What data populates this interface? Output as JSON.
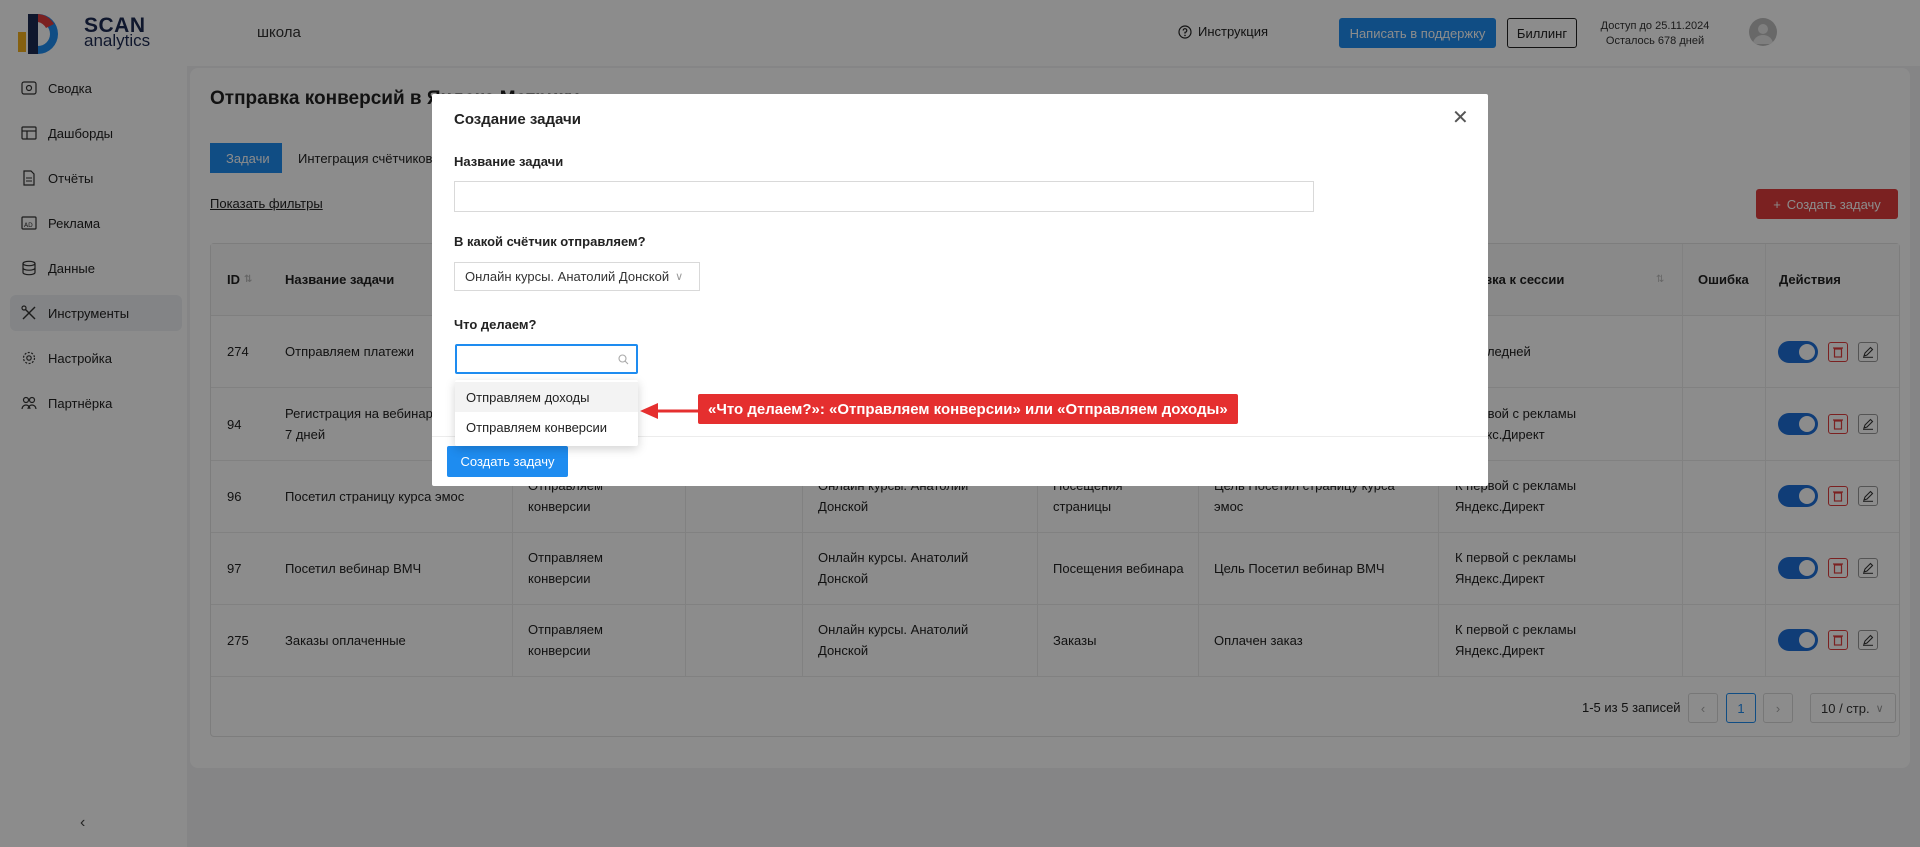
{
  "header": {
    "logo_title": "SCAN",
    "logo_sub": "analytics",
    "project": "школа",
    "instruction": "Инструкция",
    "support": "Написать в поддержку",
    "billing": "Биллинг",
    "access_line1": "Доступ до 25.11.2024",
    "access_line2": "Осталось 678 дней"
  },
  "sidebar": {
    "items": [
      {
        "label": "Сводка",
        "icon": "summary-icon"
      },
      {
        "label": "Дашборды",
        "icon": "dashboard-icon"
      },
      {
        "label": "Отчёты",
        "icon": "reports-icon"
      },
      {
        "label": "Реклама",
        "icon": "ads-icon"
      },
      {
        "label": "Данные",
        "icon": "data-icon"
      },
      {
        "label": "Инструменты",
        "icon": "tools-icon"
      },
      {
        "label": "Настройка",
        "icon": "settings-icon"
      },
      {
        "label": "Партнёрка",
        "icon": "partners-icon"
      }
    ],
    "active": "Инструменты",
    "collapse": "‹"
  },
  "page": {
    "title": "Отправка конверсий в Яндекс.Метрику",
    "tabs": [
      "Задачи",
      "Интеграция счётчиков"
    ],
    "show_filters": "Показать фильтры",
    "create_task": "Создать задачу"
  },
  "table": {
    "headers": {
      "id": "ID",
      "name": "Название задачи",
      "session": "Привязка к сессии",
      "error": "Ошибка",
      "actions": "Действия"
    },
    "rows": [
      {
        "id": "274",
        "name": "Отправляем платежи",
        "type": "",
        "counter": "",
        "source": "",
        "goal": "",
        "session": "К последней"
      },
      {
        "id": "94",
        "name": "Регистрация на вебинар 7 дней",
        "type": "",
        "counter": "",
        "source": "",
        "goal": "",
        "session": "К первой с рекламы Яндекс.Директ"
      },
      {
        "id": "96",
        "name": "Посетил страницу курса эмос",
        "type": "Отправляем конверсии",
        "counter": "Онлайн курсы. Анатолий Донской",
        "source": "Посещения страницы",
        "goal": "Цель Посетил страницу курса эмос",
        "session": "К первой с рекламы Яндекс.Директ"
      },
      {
        "id": "97",
        "name": "Посетил вебинар ВМЧ",
        "type": "Отправляем конверсии",
        "counter": "Онлайн курсы. Анатолий Донской",
        "source": "Посещения вебинара",
        "goal": "Цель Посетил вебинар ВМЧ",
        "session": "К первой с рекламы Яндекс.Директ"
      },
      {
        "id": "275",
        "name": "Заказы оплаченные",
        "type": "Отправляем конверсии",
        "counter": "Онлайн курсы. Анатолий Донской",
        "source": "Заказы",
        "goal": "Оплачен заказ",
        "session": "К первой с рекламы Яндекс.Директ"
      }
    ],
    "pager_text": "1-5 из 5 записей",
    "page": "1",
    "page_size": "10 / стр."
  },
  "modal": {
    "title": "Создание задачи",
    "name_label": "Название задачи",
    "name_value": "",
    "counter_label": "В какой счётчик отправляем?",
    "counter_value": "Онлайн курсы. Анатолий Донской",
    "action_label": "Что делаем?",
    "action_search": "",
    "options": [
      "Отправляем доходы",
      "Отправляем конверсии"
    ],
    "submit": "Создать задачу"
  },
  "annotation": {
    "text": "«Что делаем?»: «Отправляем конверсии» или «Отправляем доходы»"
  },
  "colors": {
    "primary": "#1e8cf0",
    "danger": "#e03c3c",
    "callout": "#e52f2f"
  }
}
